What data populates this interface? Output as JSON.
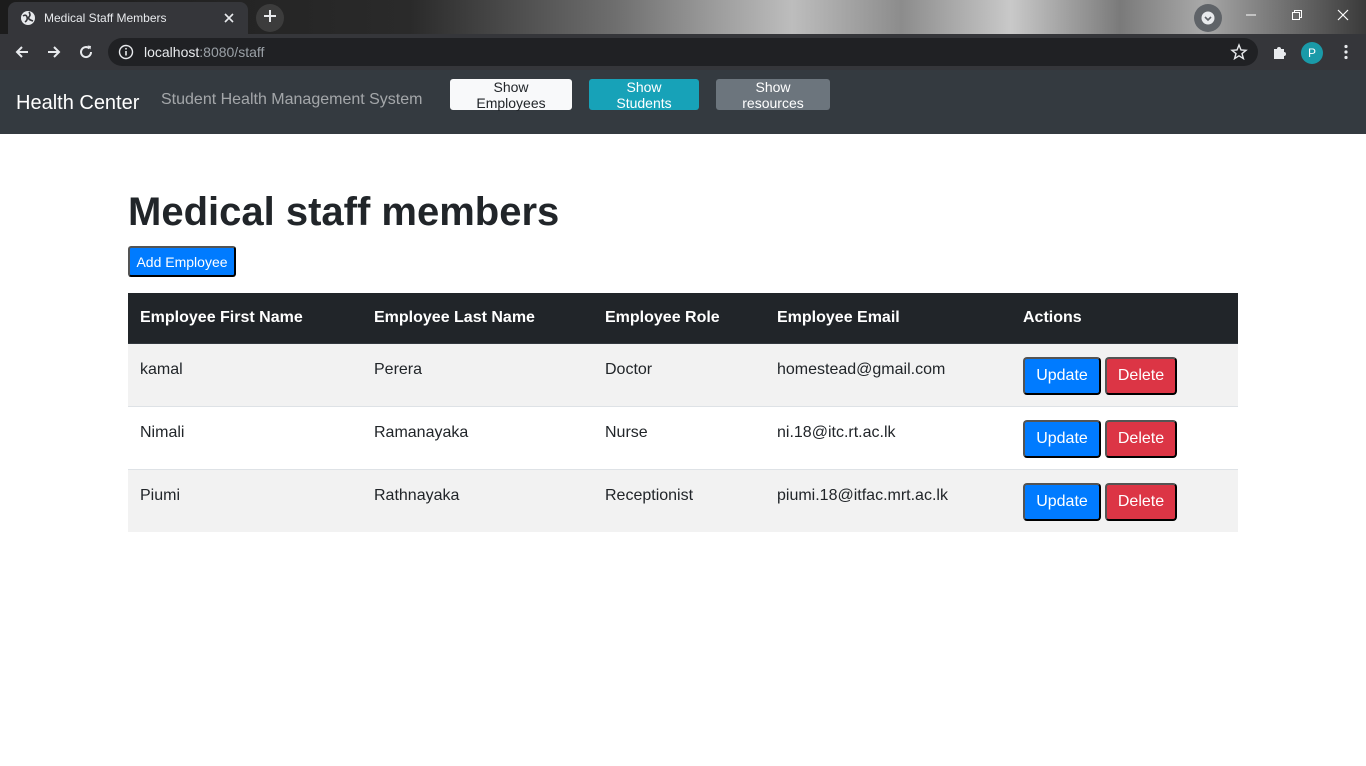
{
  "browser": {
    "tab_title": "Medical Staff Members",
    "url_host": "localhost",
    "url_path": ":8080/staff",
    "profile_initial": "P",
    "icons": [
      "globe-icon",
      "close-icon",
      "plus-icon",
      "back-arrow-icon",
      "forward-arrow-icon",
      "reload-icon",
      "info-icon",
      "star-icon",
      "puzzle-icon",
      "kebab-menu-icon"
    ]
  },
  "navbar": {
    "brand": "Health Center",
    "subtitle": "Student Health Management System",
    "buttons": {
      "employees": "Show Employees",
      "students": "Show Students",
      "resources": "Show resources"
    }
  },
  "main": {
    "title": "Medical staff members",
    "add_button": "Add Employee",
    "table": {
      "headers": [
        "Employee First Name",
        "Employee Last Name",
        "Employee Role",
        "Employee Email",
        "Actions"
      ],
      "rows": [
        {
          "first": "kamal",
          "last": "Perera",
          "role": "Doctor",
          "email": "homestead@gmail.com",
          "update": "Update",
          "delete": "Delete"
        },
        {
          "first": "Nimali",
          "last": "Ramanayaka",
          "role": "Nurse",
          "email": "ni.18@itc.rt.ac.lk",
          "update": "Update",
          "delete": "Delete"
        },
        {
          "first": "Piumi",
          "last": "Rathnayaka",
          "role": "Receptionist",
          "email": "piumi.18@itfac.mrt.ac.lk",
          "update": "Update",
          "delete": "Delete"
        }
      ]
    }
  },
  "colors": {
    "navbar_bg": "#343a40",
    "primary": "#007bff",
    "danger": "#dc3545",
    "info": "#17a2b8",
    "secondary": "#6c757d",
    "table_header_bg": "#212529"
  }
}
